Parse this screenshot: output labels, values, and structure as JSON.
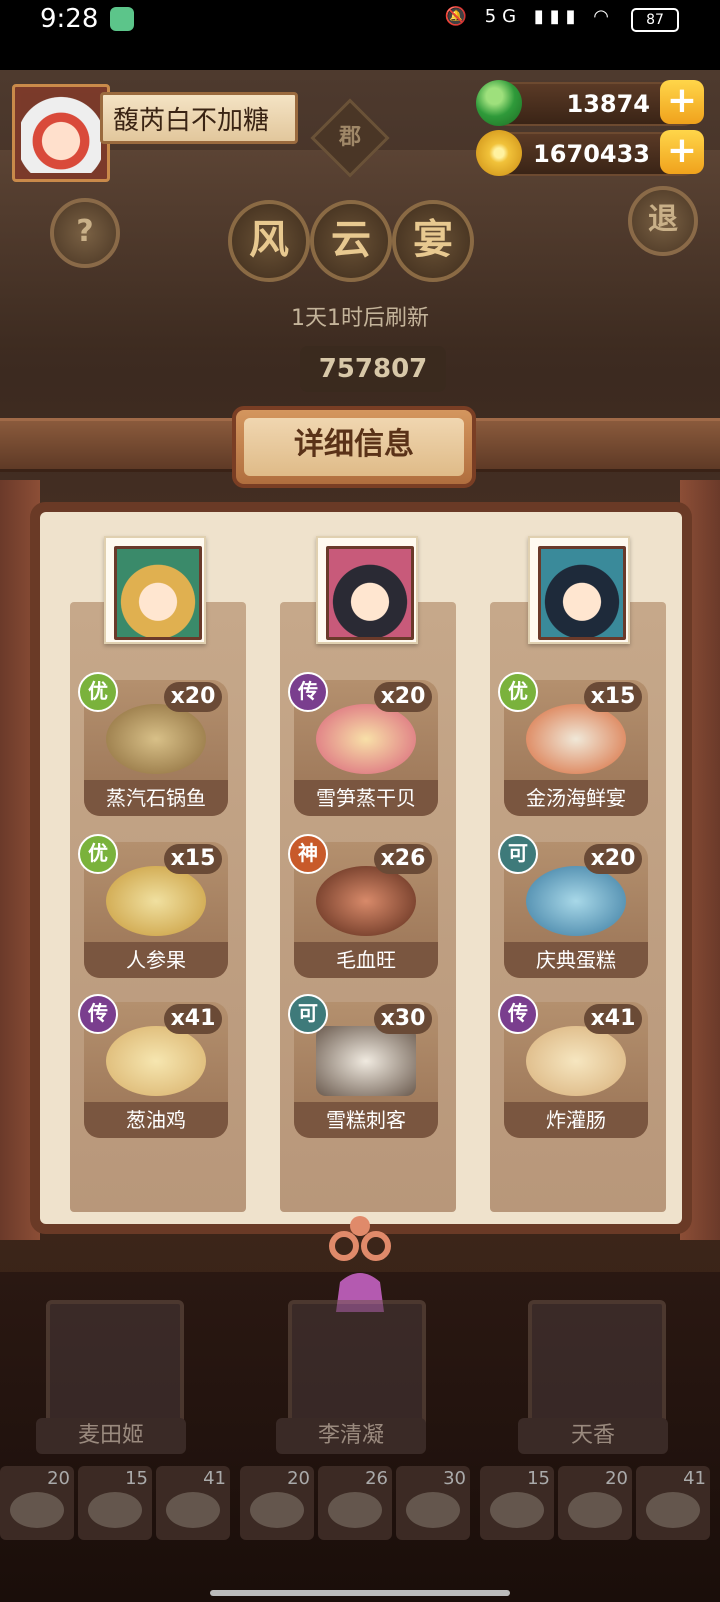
{
  "status_bar": {
    "time": "9:28",
    "network": "5G",
    "battery": "87"
  },
  "player": {
    "name": "馥芮白不加糖"
  },
  "currency": {
    "jade": "13874",
    "coins": "1670433"
  },
  "buttons": {
    "help": "?",
    "exit": "退"
  },
  "region_badge": "郡",
  "title_chars": [
    "风",
    "云",
    "宴"
  ],
  "refresh_text": "1天1时后刷新",
  "score": "757807",
  "detail_button": "详细信息",
  "columns": [
    {
      "dishes": [
        {
          "name": "蒸汽石锅鱼",
          "qty": "x20",
          "grade": "优",
          "grade_color": "#7ab23c"
        },
        {
          "name": "人参果",
          "qty": "x15",
          "grade": "优",
          "grade_color": "#7ab23c"
        },
        {
          "name": "葱油鸡",
          "qty": "x41",
          "grade": "传",
          "grade_color": "#7a3e8e"
        }
      ]
    },
    {
      "dishes": [
        {
          "name": "雪笋蒸干贝",
          "qty": "x20",
          "grade": "传",
          "grade_color": "#7a3e8e"
        },
        {
          "name": "毛血旺",
          "qty": "x26",
          "grade": "神",
          "grade_color": "#c85a2a"
        },
        {
          "name": "雪糕刺客",
          "qty": "x30",
          "grade": "可",
          "grade_color": "#3e7a7a"
        }
      ]
    },
    {
      "dishes": [
        {
          "name": "金汤海鲜宴",
          "qty": "x15",
          "grade": "优",
          "grade_color": "#7ab23c"
        },
        {
          "name": "庆典蛋糕",
          "qty": "x20",
          "grade": "可",
          "grade_color": "#3e7a7a"
        },
        {
          "name": "炸灌肠",
          "qty": "x41",
          "grade": "传",
          "grade_color": "#7a3e8e"
        }
      ]
    }
  ],
  "characters": [
    {
      "name": "麦田姬"
    },
    {
      "name": "李清凝"
    },
    {
      "name": "天香"
    }
  ],
  "dish_strip": [
    "20",
    "15",
    "41",
    "20",
    "26",
    "30",
    "15",
    "20",
    "41"
  ]
}
